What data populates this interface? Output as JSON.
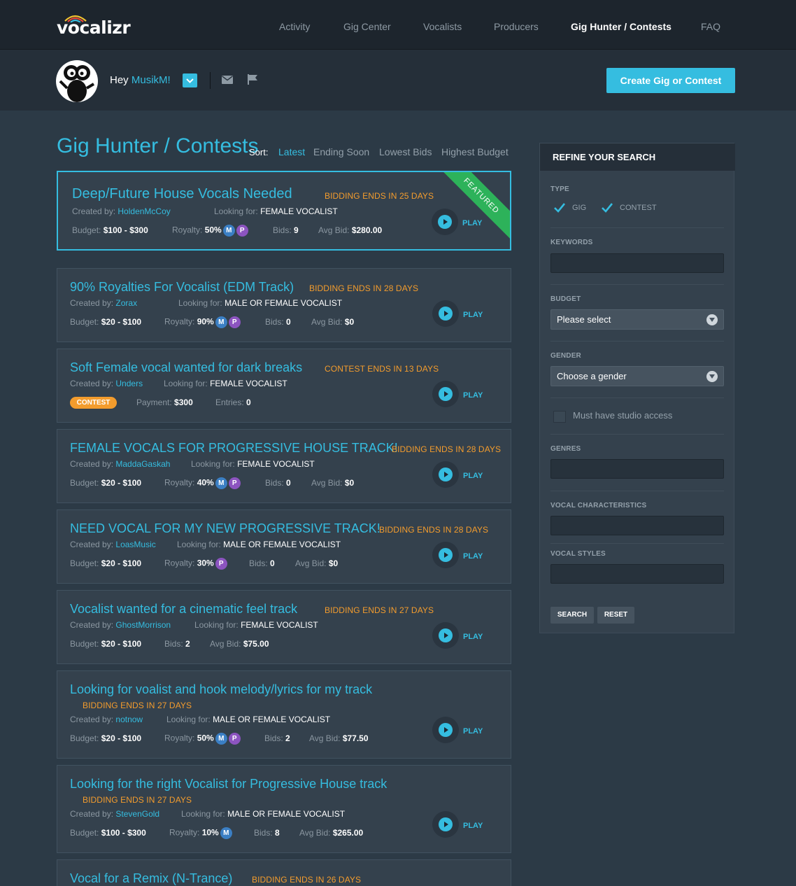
{
  "brand": {
    "logo_text": "vocalizr",
    "accent": "#35bde0",
    "warning": "#f39c2d",
    "featured": "#2db25a"
  },
  "nav": {
    "items": [
      "Activity",
      "Gig Center",
      "Vocalists",
      "Producers",
      "Gig Hunter / Contests",
      "FAQ"
    ],
    "active": "Gig Hunter / Contests"
  },
  "user": {
    "greeting": "Hey",
    "name": "MusikM!",
    "create_button": "Create Gig or Contest"
  },
  "page": {
    "title": "Gig Hunter / Contests",
    "sort_label": "Sort:",
    "sort_options": [
      "Latest",
      "Ending Soon",
      "Lowest Bids",
      "Highest Budget"
    ],
    "active_sort": "Latest"
  },
  "labels": {
    "created_by": "Created by:",
    "looking_for": "Looking for:",
    "budget": "Budget:",
    "royalty": "Royalty:",
    "bids": "Bids:",
    "avg_bid": "Avg Bid:",
    "payment": "Payment:",
    "entries": "Entries:",
    "play": "PLAY",
    "contest": "CONTEST",
    "featured": "FEATURED",
    "m": "M",
    "p": "P"
  },
  "gigs": [
    {
      "title": "Deep/Future House Vocals Needed",
      "ends": "BIDDING ENDS IN 25 DAYS",
      "creator": "HoldenMcCoy",
      "looking_for": "FEMALE VOCALIST",
      "budget": "$100 - $300",
      "royalty": "50%",
      "bids": "9",
      "avg_bid": "$280.00"
    },
    {
      "title": "90% Royalties For Vocalist (EDM Track)",
      "ends": "BIDDING ENDS IN 28 DAYS",
      "creator": "Zorax",
      "looking_for": "MALE OR FEMALE VOCALIST",
      "budget": "$20 - $100",
      "royalty": "90%",
      "bids": "0",
      "avg_bid": "$0"
    },
    {
      "title": "Soft Female vocal wanted for dark breaks",
      "ends": "CONTEST ENDS IN 13 DAYS",
      "creator": "Unders",
      "looking_for": "FEMALE VOCALIST",
      "payment": "$300",
      "entries": "0"
    },
    {
      "title": "FEMALE VOCALS FOR PROGRESSIVE HOUSE TRACK!",
      "ends": "BIDDING ENDS IN 28 DAYS",
      "creator": "MaddaGaskah",
      "looking_for": "FEMALE VOCALIST",
      "budget": "$20 - $100",
      "royalty": "40%",
      "bids": "0",
      "avg_bid": "$0"
    },
    {
      "title": "NEED VOCAL FOR MY NEW PROGRESSIVE TRACK!",
      "ends": "BIDDING ENDS IN 28 DAYS",
      "creator": "LoasMusic",
      "looking_for": "MALE OR FEMALE VOCALIST",
      "budget": "$20 - $100",
      "royalty": "30%",
      "bids": "0",
      "avg_bid": "$0"
    },
    {
      "title": "Vocalist wanted for a cinematic feel track",
      "ends": "BIDDING ENDS IN 27 DAYS",
      "creator": "GhostMorrison",
      "looking_for": "FEMALE VOCALIST",
      "budget": "$20 - $100",
      "bids": "2",
      "avg_bid": "$75.00"
    },
    {
      "title": "Looking for voalist and hook melody/lyrics for my track",
      "ends": "BIDDING ENDS IN 27 DAYS",
      "creator": "notnow",
      "looking_for": "MALE OR FEMALE VOCALIST",
      "budget": "$20 - $100",
      "royalty": "50%",
      "bids": "2",
      "avg_bid": "$77.50"
    },
    {
      "title": "Looking for the right Vocalist for Progressive House track",
      "ends": "BIDDING ENDS IN 27 DAYS",
      "creator": "StevenGold",
      "looking_for": "MALE OR FEMALE VOCALIST",
      "budget": "$100 - $300",
      "royalty": "10%",
      "bids": "8",
      "avg_bid": "$265.00"
    },
    {
      "title": "Vocal for a Remix (N-Trance)",
      "ends": "BIDDING ENDS IN 26 DAYS"
    }
  ],
  "sidebar": {
    "header": "REFINE YOUR SEARCH",
    "type_label": "TYPE",
    "type_options": [
      "GIG",
      "CONTEST"
    ],
    "keywords_label": "KEYWORDS",
    "budget_label": "BUDGET",
    "budget_value": "Please select",
    "gender_label": "GENDER",
    "gender_value": "Choose a gender",
    "studio_label": "Must have studio access",
    "genres_label": "GENRES",
    "vocal_char_label": "VOCAL CHARACTERISTICS",
    "vocal_styles_label": "VOCAL STYLES",
    "search_button": "SEARCH",
    "reset_button": "RESET"
  }
}
